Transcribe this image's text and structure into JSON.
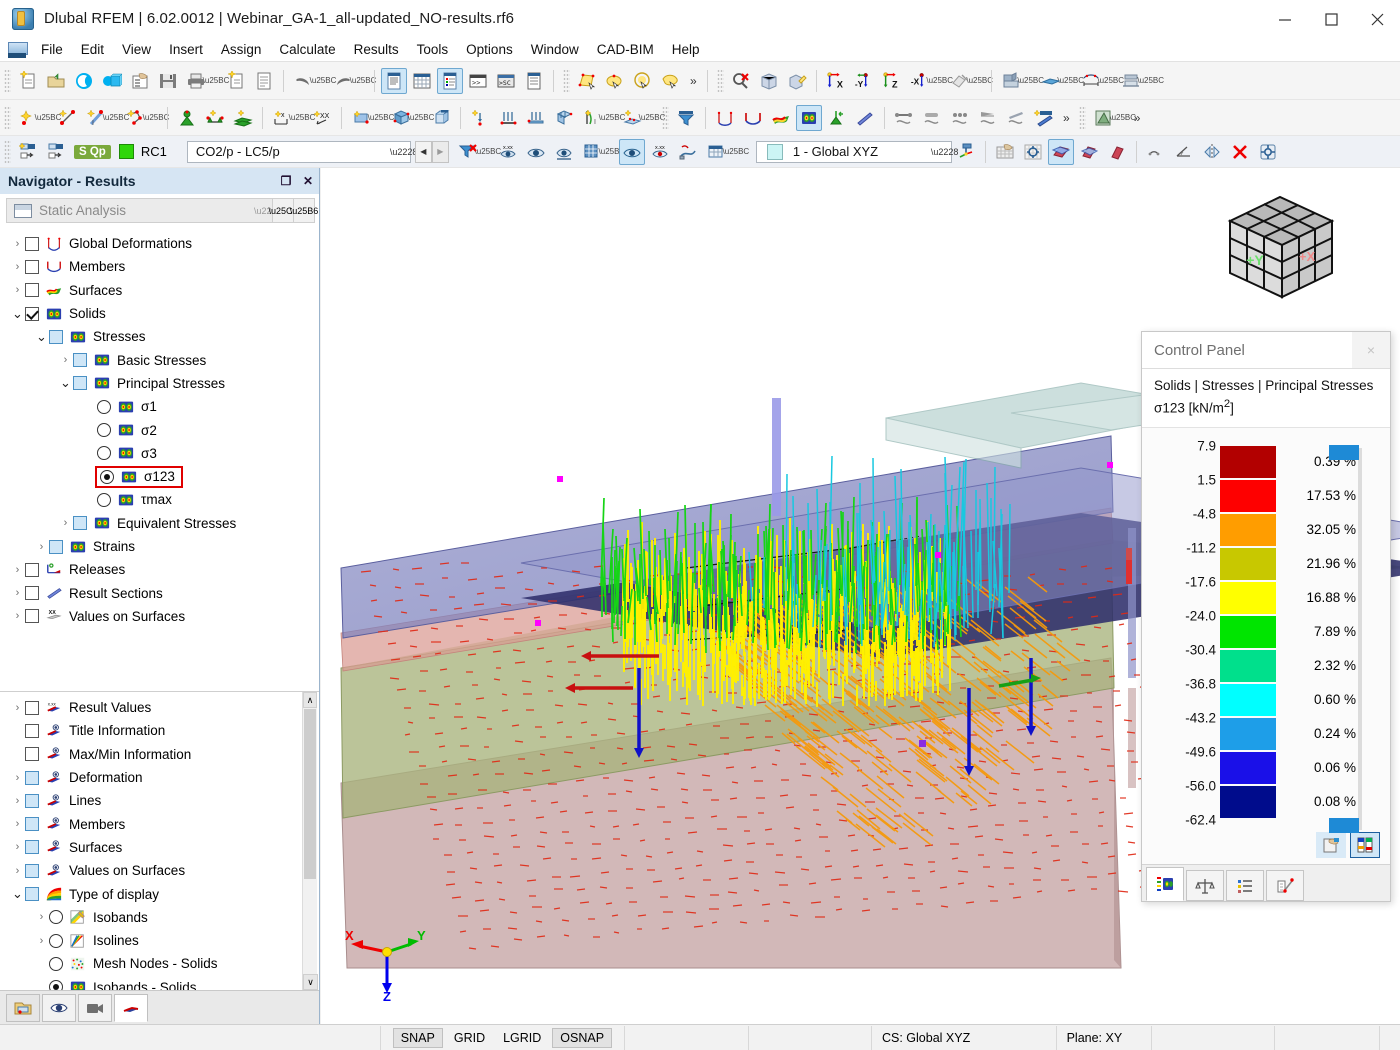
{
  "window": {
    "title": "Dlubal RFEM | 6.02.0012 | Webinar_GA-1_all-updated_NO-results.rf6",
    "minimize": "—",
    "maximize": "☐",
    "close": "✕"
  },
  "menu": {
    "items": [
      "File",
      "Edit",
      "View",
      "Insert",
      "Assign",
      "Calculate",
      "Results",
      "Tools",
      "Options",
      "Window",
      "CAD-BIM",
      "Help"
    ]
  },
  "toolbar_overflow": "»",
  "loadcase_bar": {
    "tag": "S Qp",
    "rc_label": "RC1",
    "combo_value": "CO2/p - LC5/p",
    "prev": "◀",
    "next": "▶",
    "cs_value": "1 - Global XYZ"
  },
  "navigator": {
    "title": "Navigator - Results",
    "restore_icon": "❐",
    "close_icon": "✕",
    "analysis_select": "Static Analysis",
    "tree_top": [
      {
        "label": "Global Deformations",
        "depth": 0,
        "toggle": "collapsed",
        "control": "checkbox",
        "checked": false,
        "icon": "deformation-icon"
      },
      {
        "label": "Members",
        "depth": 0,
        "toggle": "collapsed",
        "control": "checkbox",
        "checked": false,
        "icon": "members-icon"
      },
      {
        "label": "Surfaces",
        "depth": 0,
        "toggle": "collapsed",
        "control": "checkbox",
        "checked": false,
        "icon": "surfaces-icon"
      },
      {
        "label": "Solids",
        "depth": 0,
        "toggle": "expanded",
        "control": "checkbox",
        "checked": true,
        "icon": "solids-icon"
      },
      {
        "label": "Stresses",
        "depth": 1,
        "toggle": "expanded",
        "control": "checkbox-blue",
        "checked": false,
        "icon": "solids-icon"
      },
      {
        "label": "Basic Stresses",
        "depth": 2,
        "toggle": "collapsed",
        "control": "checkbox-blue",
        "checked": false,
        "icon": "solids-icon"
      },
      {
        "label": "Principal Stresses",
        "depth": 2,
        "toggle": "expanded",
        "control": "checkbox-blue",
        "checked": false,
        "icon": "solids-icon"
      },
      {
        "label": "σ1",
        "depth": 3,
        "toggle": "none",
        "control": "radio",
        "checked": false,
        "icon": "solids-icon"
      },
      {
        "label": "σ2",
        "depth": 3,
        "toggle": "none",
        "control": "radio",
        "checked": false,
        "icon": "solids-icon"
      },
      {
        "label": "σ3",
        "depth": 3,
        "toggle": "none",
        "control": "radio",
        "checked": false,
        "icon": "solids-icon"
      },
      {
        "label": "σ123",
        "depth": 3,
        "toggle": "none",
        "control": "radio",
        "checked": true,
        "icon": "solids-icon",
        "highlight": true
      },
      {
        "label": "τmax",
        "depth": 3,
        "toggle": "none",
        "control": "radio",
        "checked": false,
        "icon": "solids-icon"
      },
      {
        "label": "Equivalent Stresses",
        "depth": 2,
        "toggle": "collapsed",
        "control": "checkbox-blue",
        "checked": false,
        "icon": "solids-icon"
      },
      {
        "label": "Strains",
        "depth": 1,
        "toggle": "collapsed",
        "control": "checkbox-blue",
        "checked": false,
        "icon": "solids-icon"
      },
      {
        "label": "Releases",
        "depth": 0,
        "toggle": "collapsed",
        "control": "checkbox",
        "checked": false,
        "icon": "releases-icon"
      },
      {
        "label": "Result Sections",
        "depth": 0,
        "toggle": "collapsed",
        "control": "checkbox",
        "checked": false,
        "icon": "result-sections-icon"
      },
      {
        "label": "Values on Surfaces",
        "depth": 0,
        "toggle": "collapsed",
        "control": "checkbox",
        "checked": false,
        "icon": "values-on-surfaces-icon"
      }
    ],
    "tree_bottom": [
      {
        "label": "Result Values",
        "depth": 0,
        "toggle": "collapsed",
        "control": "checkbox",
        "checked": false,
        "icon": "result-values-icon"
      },
      {
        "label": "Title Information",
        "depth": 0,
        "toggle": "none",
        "control": "checkbox",
        "checked": false,
        "icon": "display-icon"
      },
      {
        "label": "Max/Min Information",
        "depth": 0,
        "toggle": "none",
        "control": "checkbox",
        "checked": false,
        "icon": "display-icon"
      },
      {
        "label": "Deformation",
        "depth": 0,
        "toggle": "collapsed",
        "control": "checkbox-blue",
        "checked": false,
        "icon": "display-icon"
      },
      {
        "label": "Lines",
        "depth": 0,
        "toggle": "collapsed",
        "control": "checkbox-blue",
        "checked": false,
        "icon": "display-icon"
      },
      {
        "label": "Members",
        "depth": 0,
        "toggle": "collapsed",
        "control": "checkbox-blue",
        "checked": false,
        "icon": "display-icon"
      },
      {
        "label": "Surfaces",
        "depth": 0,
        "toggle": "collapsed",
        "control": "checkbox-blue",
        "checked": false,
        "icon": "display-icon"
      },
      {
        "label": "Values on Surfaces",
        "depth": 0,
        "toggle": "collapsed",
        "control": "checkbox-blue",
        "checked": false,
        "icon": "display-icon"
      },
      {
        "label": "Type of display",
        "depth": 0,
        "toggle": "expanded",
        "control": "checkbox-blue",
        "checked": false,
        "icon": "rainbow-icon"
      },
      {
        "label": "Isobands",
        "depth": 1,
        "toggle": "collapsed",
        "control": "radio",
        "checked": false,
        "icon": "isobands-icon"
      },
      {
        "label": "Isolines",
        "depth": 1,
        "toggle": "collapsed",
        "control": "radio",
        "checked": false,
        "icon": "isolines-icon"
      },
      {
        "label": "Mesh Nodes - Solids",
        "depth": 1,
        "toggle": "none",
        "control": "radio",
        "checked": false,
        "icon": "mesh-nodes-icon"
      },
      {
        "label": "Isobands - Solids",
        "depth": 1,
        "toggle": "none",
        "control": "radio",
        "checked": true,
        "icon": "solids-icon"
      }
    ],
    "scroll_up": "∧",
    "scroll_down": "∨",
    "tabs": [
      "project-navigator-tab",
      "display-navigator-tab",
      "views-navigator-tab",
      "results-navigator-tab"
    ]
  },
  "viewport": {
    "cube_face_y": "+Y",
    "cube_face_x": "+X",
    "axis_x": "X",
    "axis_y": "Y",
    "axis_z": "Z"
  },
  "control_panel": {
    "title": "Control Panel",
    "close_icon": "×",
    "subtitle_line1": "Solids | Stresses | Principal Stresses",
    "subtitle_line2_pre": "σ123 [kN/m",
    "subtitle_line2_sup": "2",
    "subtitle_line2_post": "]",
    "mid_buttons": [
      "edit-colors-button",
      "color-scale-button"
    ],
    "tabs": [
      "color-scale-tab",
      "factors-tab",
      "filter-tab",
      "display-tab"
    ]
  },
  "chart_data": {
    "type": "bar",
    "title": "Solids | Stresses | Principal Stresses σ123 [kN/m2]",
    "xlabel": "",
    "ylabel": "σ123 [kN/m2]",
    "boundaries": [
      "7.9",
      "1.5",
      "-4.8",
      "-11.2",
      "-17.6",
      "-24.0",
      "-30.4",
      "-36.8",
      "-43.2",
      "-49.6",
      "-56.0",
      "-62.4"
    ],
    "categories": [
      "7.9 .. 1.5",
      "1.5 .. -4.8",
      "-4.8 .. -11.2",
      "-11.2 .. -17.6",
      "-17.6 .. -24.0",
      "-24.0 .. -30.4",
      "-30.4 .. -36.8",
      "-36.8 .. -43.2",
      "-43.2 .. -49.6",
      "-49.6 .. -56.0",
      "-56.0 .. -62.4"
    ],
    "values": [
      0.39,
      17.53,
      32.05,
      21.96,
      16.88,
      7.89,
      2.32,
      0.6,
      0.24,
      0.06,
      0.08
    ],
    "value_labels": [
      "0.39 %",
      "17.53 %",
      "32.05 %",
      "21.96 %",
      "16.88 %",
      "7.89 %",
      "2.32 %",
      "0.60 %",
      "0.24 %",
      "0.06 %",
      "0.08 %"
    ],
    "colors": [
      "#b20000",
      "#fe0000",
      "#ff9d00",
      "#c8c800",
      "#ffff00",
      "#00e500",
      "#00e08c",
      "#00ffff",
      "#1e9ee8",
      "#1a10e8",
      "#000c8c"
    ],
    "unit": "%",
    "legend_position": "right",
    "grid": false
  },
  "statusbar": {
    "toggles": [
      "SNAP",
      "GRID",
      "LGRID",
      "OSNAP"
    ],
    "active_toggles": [
      "SNAP",
      "OSNAP"
    ],
    "cs": "CS: Global XYZ",
    "plane": "Plane: XY"
  }
}
